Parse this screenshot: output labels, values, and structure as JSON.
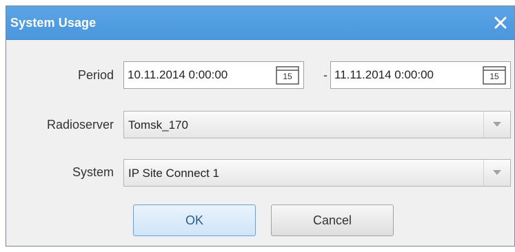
{
  "window": {
    "title": "System Usage",
    "close_icon": "close-icon"
  },
  "period": {
    "label": "Period",
    "from_value": "10.11.2014 0:00:00",
    "to_value": "11.11.2014 0:00:00",
    "separator": "-",
    "calendar_day": "15",
    "calendar_icon": "calendar-icon"
  },
  "radioserver": {
    "label": "Radioserver",
    "value": "Tomsk_170",
    "dropdown_icon": "chevron-down-icon"
  },
  "system": {
    "label": "System",
    "value": "IP Site Connect 1",
    "dropdown_icon": "chevron-down-icon"
  },
  "buttons": {
    "ok_label": "OK",
    "cancel_label": "Cancel"
  },
  "colors": {
    "titlebar": "#4b97dd",
    "dialog_bg": "#f0f0f0",
    "ok_border": "#5ea3de"
  }
}
